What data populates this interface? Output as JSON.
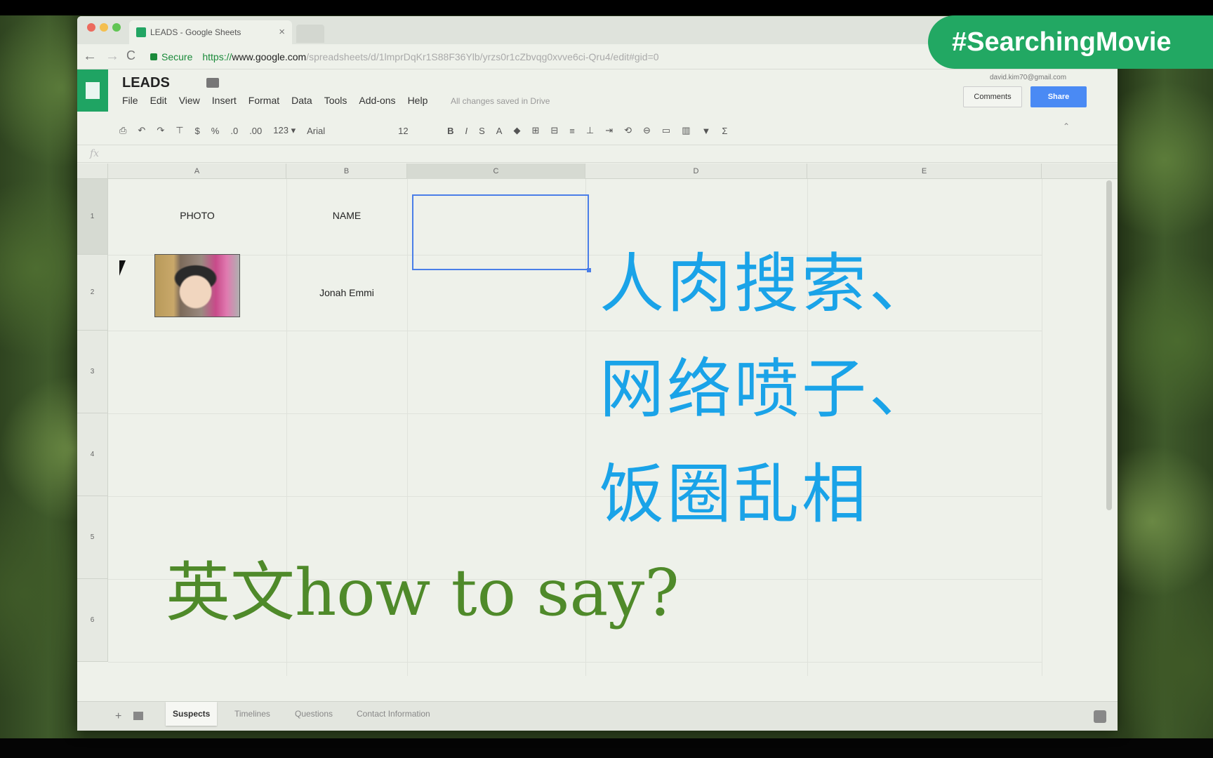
{
  "browser": {
    "tab_title": "LEADS - Google Sheets",
    "tab_close": "×",
    "back": "←",
    "forward": "→",
    "reload": "C",
    "secure_label": "Secure",
    "url_proto": "https://",
    "url_host": "www.google.com",
    "url_path": "/spreadsheets/d/1lmprDqKr1S88F36Ylb/yrzs0r1cZbvqg0xvve6ci-Qru4/edit#gid=0"
  },
  "sheets": {
    "title": "LEADS",
    "menu": [
      "File",
      "Edit",
      "View",
      "Insert",
      "Format",
      "Data",
      "Tools",
      "Add-ons",
      "Help"
    ],
    "save_status": "All changes saved in Drive",
    "user_email": "david.kim70@gmail.com",
    "comments_label": "Comments",
    "share_label": "Share",
    "toolbar": {
      "print": "⎙",
      "undo": "↶",
      "redo": "↷",
      "paint": "⊤",
      "currency": "$",
      "percent": "%",
      "dec_down": ".0",
      "dec_up": ".00",
      "format_123": "123 ▾",
      "font": "Arial",
      "font_size": "12",
      "bold": "B",
      "italic": "I",
      "strike": "S",
      "text_color": "A",
      "fill": "◆",
      "borders": "⊞",
      "merge": "⊟",
      "halign": "≡",
      "valign": "⊥",
      "wrap": "⇥",
      "rotate": "⟲",
      "link": "⊖",
      "comment": "▭",
      "chart": "▥",
      "filter": "▼",
      "functions": "Σ"
    },
    "fx": "fx",
    "columns": [
      "A",
      "B",
      "C",
      "D",
      "E"
    ],
    "rows": [
      "1",
      "2",
      "3",
      "4",
      "5",
      "6"
    ],
    "cells": {
      "a1": "PHOTO",
      "b1": "NAME",
      "b2": "Jonah Emmi"
    },
    "sheet_tabs": [
      "Suspects",
      "Timelines",
      "Questions",
      "Contact Information"
    ],
    "add_sheet": "+"
  },
  "overlay": {
    "hashtag": "#SearchingMovie",
    "cn_lines": [
      "人肉搜索、",
      "网络喷子、",
      "饭圈乱相"
    ],
    "en_caption": "英文how to say?"
  },
  "colors": {
    "sheets_green": "#1fa463",
    "share_blue": "#4a8af4",
    "caption_blue": "#1aa3e8",
    "caption_green": "#4f8a2a",
    "badge_green": "#22a863"
  }
}
